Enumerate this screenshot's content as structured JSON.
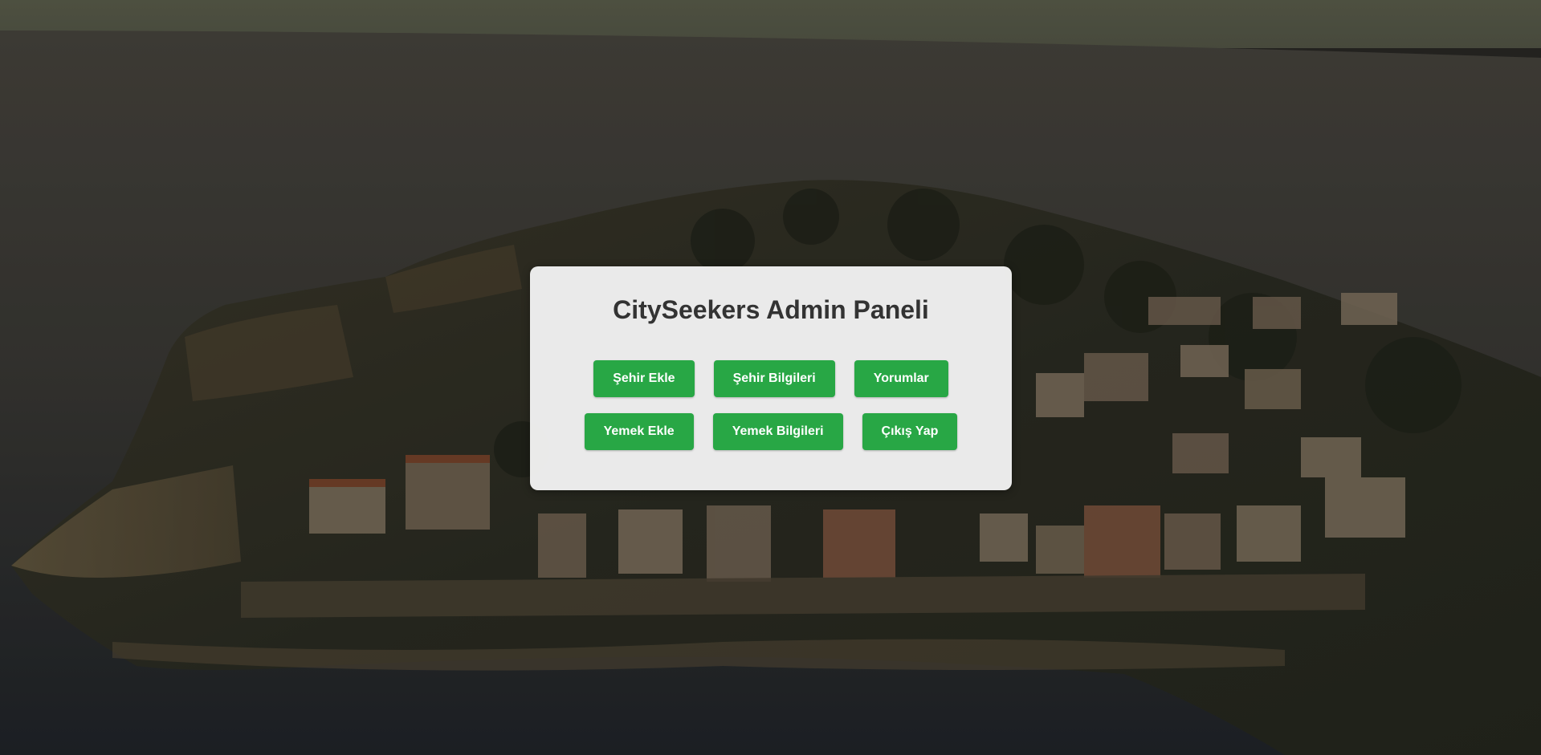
{
  "panel": {
    "title": "CitySeekers Admin Paneli"
  },
  "buttons": {
    "row1": [
      {
        "label": "Şehir Ekle"
      },
      {
        "label": "Şehir Bilgileri"
      },
      {
        "label": "Yorumlar"
      }
    ],
    "row2": [
      {
        "label": "Yemek Ekle"
      },
      {
        "label": "Yemek Bilgileri"
      },
      {
        "label": "Çıkış Yap"
      }
    ]
  },
  "colors": {
    "button_bg": "#28a745",
    "button_text": "#ffffff",
    "panel_bg": "#f2f2f2",
    "title_text": "#333333"
  }
}
